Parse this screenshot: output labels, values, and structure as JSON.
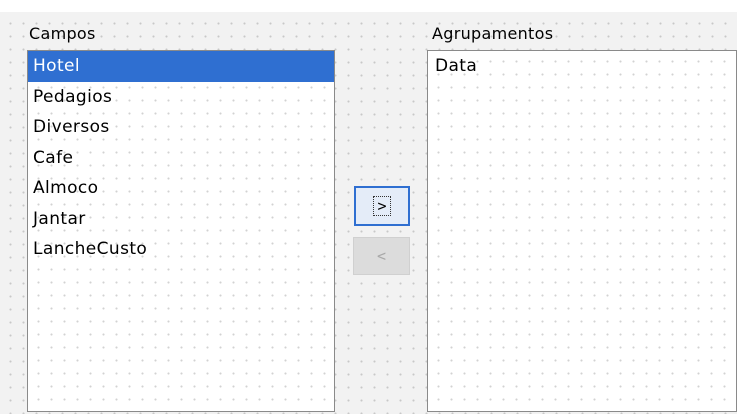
{
  "fields_label": "Campos",
  "groupings_label": "Agrupamentos",
  "fields": [
    {
      "label": "Hotel",
      "selected": true
    },
    {
      "label": "Pedagios",
      "selected": false
    },
    {
      "label": "Diversos",
      "selected": false
    },
    {
      "label": "Cafe",
      "selected": false
    },
    {
      "label": "Almoco",
      "selected": false
    },
    {
      "label": "Jantar",
      "selected": false
    },
    {
      "label": "LancheCusto",
      "selected": false
    }
  ],
  "groupings": [
    {
      "label": "Data",
      "selected": false
    }
  ],
  "buttons": {
    "add_label": ">",
    "remove_label": "<",
    "add_enabled": true,
    "remove_enabled": false
  },
  "colors": {
    "selection": "#2f6fd1",
    "border": "#8a8a8a",
    "background": "#f2f2f2"
  }
}
